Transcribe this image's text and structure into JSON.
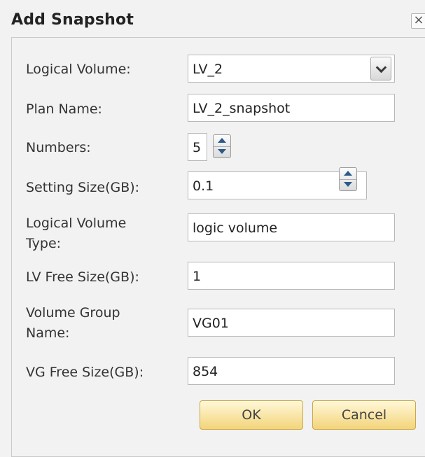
{
  "dialog": {
    "title": "Add Snapshot",
    "close_glyph": "×",
    "close_icon": "close-icon"
  },
  "form": {
    "logical_volume": {
      "label": "Logical Volume:",
      "value": "LV_2"
    },
    "plan_name": {
      "label": "Plan Name:",
      "value": "LV_2_snapshot"
    },
    "numbers": {
      "label": "Numbers:",
      "value": "5"
    },
    "setting_size": {
      "label": "Setting Size(GB):",
      "value": "0.1"
    },
    "lv_type": {
      "label_line1": "Logical Volume",
      "label_line2": "Type:",
      "value": "logic volume"
    },
    "lv_free_size": {
      "label": "LV Free Size(GB):",
      "value": "1"
    },
    "vg_name": {
      "label_line1": "Volume Group",
      "label_line2": "Name:",
      "value": "VG01"
    },
    "vg_free_size": {
      "label": "VG Free Size(GB):",
      "value": "854"
    }
  },
  "buttons": {
    "ok_label": "OK",
    "cancel_label": "Cancel"
  },
  "colors": {
    "button_fill": "#f3d47a",
    "button_border": "#c9a84a",
    "arrow": "#2b5b8a"
  }
}
